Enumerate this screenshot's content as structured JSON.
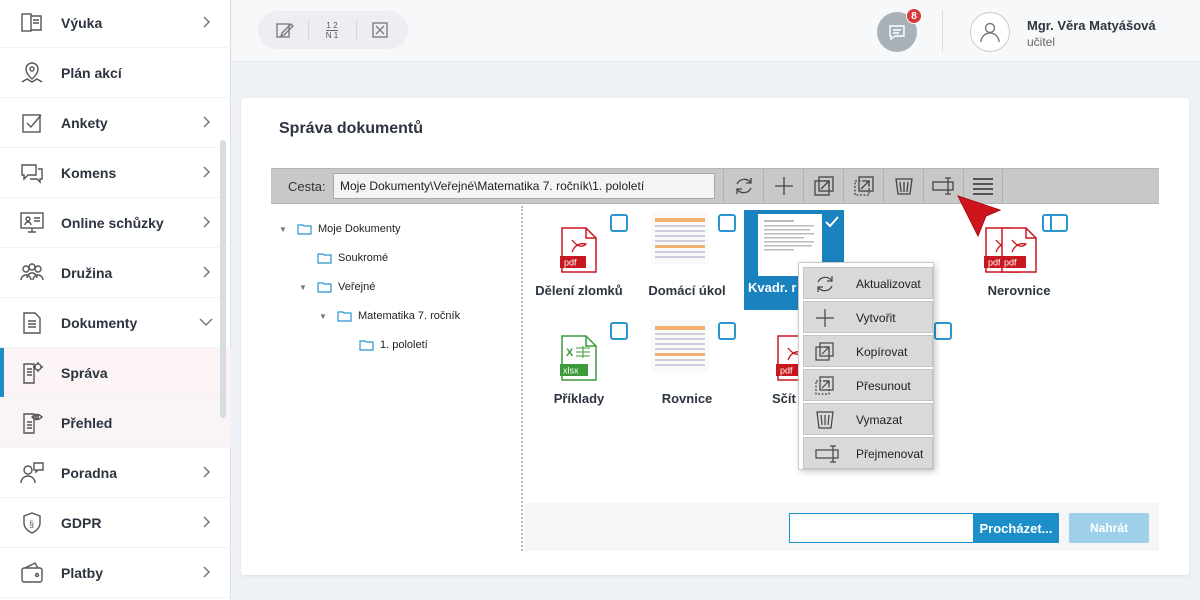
{
  "sidebar": {
    "items": [
      {
        "label": "Výuka",
        "icon": "book-icon",
        "chevron": "right"
      },
      {
        "label": "Plán akcí",
        "icon": "map-pin-icon",
        "chevron": ""
      },
      {
        "label": "Ankety",
        "icon": "checkbox-icon",
        "chevron": "right"
      },
      {
        "label": "Komens",
        "icon": "chat-icon",
        "chevron": "right"
      },
      {
        "label": "Online schůzky",
        "icon": "monitor-icon",
        "chevron": "right"
      },
      {
        "label": "Družina",
        "icon": "group-icon",
        "chevron": "right"
      },
      {
        "label": "Dokumenty",
        "icon": "document-icon",
        "chevron": "down"
      },
      {
        "label": "Správa",
        "icon": "document-gear-icon",
        "chevron": ""
      },
      {
        "label": "Přehled",
        "icon": "document-eye-icon",
        "chevron": ""
      },
      {
        "label": "Poradna",
        "icon": "counsel-icon",
        "chevron": "right"
      },
      {
        "label": "GDPR",
        "icon": "shield-icon",
        "chevron": "right"
      },
      {
        "label": "Platby",
        "icon": "wallet-icon",
        "chevron": "right"
      }
    ]
  },
  "topbar": {
    "ratio_top": "1 2",
    "ratio_bottom": "N 1",
    "messages_count": "8",
    "user_name": "Mgr. Věra Matyášová",
    "user_role": "učitel"
  },
  "main": {
    "title": "Správa dokumentů",
    "path_label": "Cesta:",
    "path_value": "Moje Dokumenty\\Veřejné\\Matematika 7. ročník\\1. pololetí",
    "tree": [
      {
        "label": "Moje Dokumenty"
      },
      {
        "label": "Soukromé"
      },
      {
        "label": "Veřejné"
      },
      {
        "label": "Matematika 7. ročník"
      },
      {
        "label": "1. pololetí"
      }
    ],
    "files": [
      {
        "name": "Dělení zlomků",
        "type": "pdf"
      },
      {
        "name": "Domácí úkol",
        "type": "sheet"
      },
      {
        "name": "Kvadr. r",
        "type": "doc"
      },
      {
        "name": "",
        "type": "pdf"
      },
      {
        "name": "Nerovnice",
        "type": "pdf"
      },
      {
        "name": "Příklady",
        "type": "xlsx"
      },
      {
        "name": "Rovnice",
        "type": "sheet"
      },
      {
        "name": "Sčít",
        "type": "pdf"
      }
    ],
    "browse_label": "Procházet...",
    "upload_label": "Nahrát"
  },
  "context_menu": {
    "items": [
      {
        "label": "Aktualizovat",
        "icon": "refresh-icon"
      },
      {
        "label": "Vytvořit",
        "icon": "plus-icon"
      },
      {
        "label": "Kopírovat",
        "icon": "copy-icon"
      },
      {
        "label": "Přesunout",
        "icon": "move-icon"
      },
      {
        "label": "Vymazat",
        "icon": "trash-icon"
      },
      {
        "label": "Přejmenovat",
        "icon": "rename-icon"
      }
    ]
  },
  "colors": {
    "accent": "#1c8fc9",
    "selected": "#1a82bf",
    "pdf_red": "#c8171e",
    "xlsx_green": "#3d9a3a",
    "badge_red": "#d93b3b",
    "pointer_red": "#d0141c"
  }
}
